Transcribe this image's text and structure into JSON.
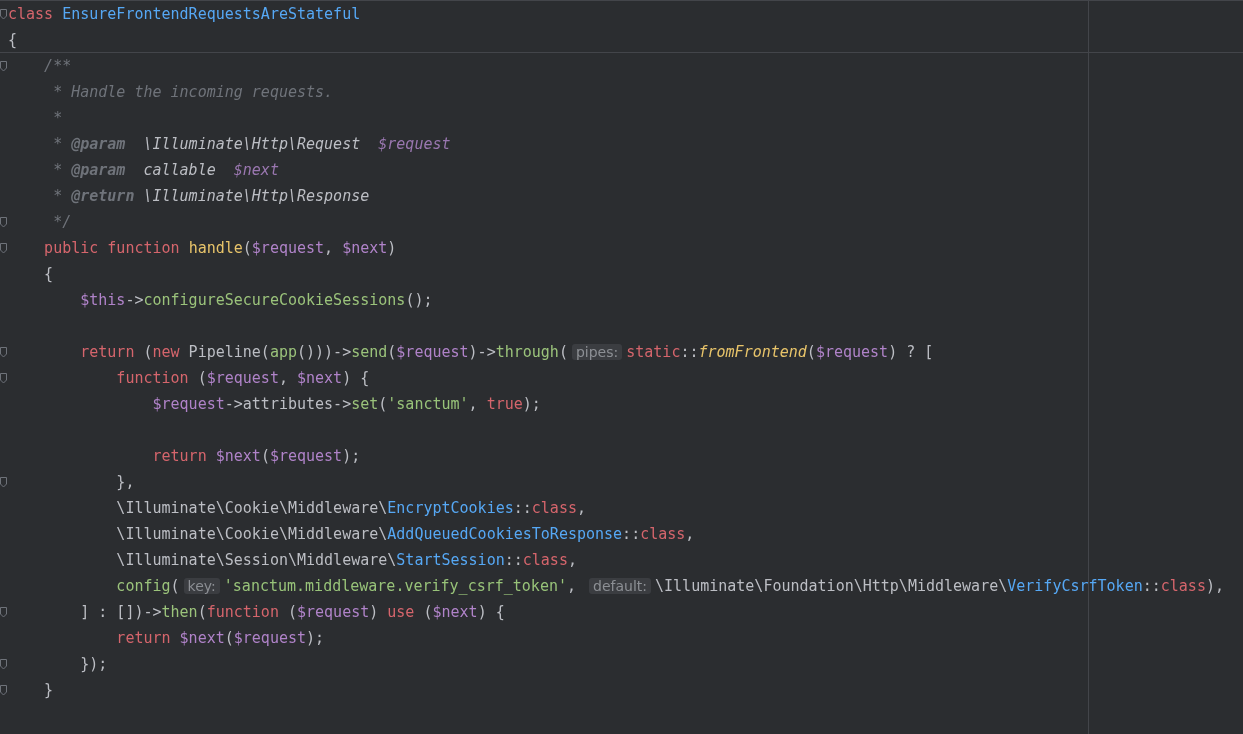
{
  "editor": {
    "lines": [
      {
        "fold": true,
        "tokens": [
          {
            "kind": "keyword",
            "text": "class "
          },
          {
            "kind": "class",
            "text": "EnsureFrontendRequestsAreStateful"
          }
        ]
      },
      {
        "fold": false,
        "tokens": [
          {
            "kind": "plain",
            "text": "{"
          }
        ]
      },
      {
        "fold": true,
        "tokens": [
          {
            "kind": "comment",
            "text": "    /**"
          }
        ]
      },
      {
        "fold": false,
        "tokens": [
          {
            "kind": "comment",
            "text": "     * Handle the incoming requests."
          }
        ]
      },
      {
        "fold": false,
        "tokens": [
          {
            "kind": "comment",
            "text": "     *"
          }
        ]
      },
      {
        "fold": false,
        "tokens": [
          {
            "kind": "comment",
            "text": "     * "
          },
          {
            "kind": "doctag",
            "text": "@param"
          },
          {
            "kind": "doctype",
            "text": "  \\Illuminate\\Http\\Request  "
          },
          {
            "kind": "docvar",
            "text": "$request"
          }
        ]
      },
      {
        "fold": false,
        "tokens": [
          {
            "kind": "comment",
            "text": "     * "
          },
          {
            "kind": "doctag",
            "text": "@param"
          },
          {
            "kind": "doctype",
            "text": "  callable  "
          },
          {
            "kind": "docvar",
            "text": "$next"
          }
        ]
      },
      {
        "fold": false,
        "tokens": [
          {
            "kind": "comment",
            "text": "     * "
          },
          {
            "kind": "doctag",
            "text": "@return"
          },
          {
            "kind": "doctype",
            "text": " \\Illuminate\\Http\\Response"
          }
        ]
      },
      {
        "fold": true,
        "tokens": [
          {
            "kind": "comment",
            "text": "     */"
          }
        ]
      },
      {
        "fold": true,
        "tokens": [
          {
            "kind": "keyword",
            "text": "    public function "
          },
          {
            "kind": "method",
            "text": "handle"
          },
          {
            "kind": "plain",
            "text": "("
          },
          {
            "kind": "variable",
            "text": "$request"
          },
          {
            "kind": "plain",
            "text": ", "
          },
          {
            "kind": "variable",
            "text": "$next"
          },
          {
            "kind": "plain",
            "text": ")"
          }
        ]
      },
      {
        "fold": false,
        "tokens": [
          {
            "kind": "plain",
            "text": "    {"
          }
        ]
      },
      {
        "fold": false,
        "tokens": [
          {
            "kind": "variable",
            "text": "        $this"
          },
          {
            "kind": "plain",
            "text": "->"
          },
          {
            "kind": "call",
            "text": "configureSecureCookieSessions"
          },
          {
            "kind": "plain",
            "text": "();"
          }
        ]
      },
      {
        "fold": false
      },
      {
        "fold": true,
        "tokens": [
          {
            "kind": "keyword",
            "text": "        return"
          },
          {
            "kind": "plain",
            "text": " ("
          },
          {
            "kind": "keyword",
            "text": "new"
          },
          {
            "kind": "plain",
            "text": " Pipeline("
          },
          {
            "kind": "call",
            "text": "app"
          },
          {
            "kind": "plain",
            "text": "()))->"
          },
          {
            "kind": "call",
            "text": "send"
          },
          {
            "kind": "plain",
            "text": "("
          },
          {
            "kind": "variable",
            "text": "$request"
          },
          {
            "kind": "plain",
            "text": ")->"
          },
          {
            "kind": "call",
            "text": "through"
          },
          {
            "kind": "plain",
            "text": "("
          },
          {
            "kind": "hint",
            "text": "pipes:"
          },
          {
            "kind": "keyword",
            "text": "static"
          },
          {
            "kind": "plain",
            "text": "::"
          },
          {
            "kind": "static",
            "text": "fromFrontend"
          },
          {
            "kind": "plain",
            "text": "("
          },
          {
            "kind": "variable",
            "text": "$request"
          },
          {
            "kind": "plain",
            "text": ") ? ["
          }
        ]
      },
      {
        "fold": true,
        "tokens": [
          {
            "kind": "keyword",
            "text": "            function"
          },
          {
            "kind": "plain",
            "text": " ("
          },
          {
            "kind": "variable",
            "text": "$request"
          },
          {
            "kind": "plain",
            "text": ", "
          },
          {
            "kind": "variable",
            "text": "$next"
          },
          {
            "kind": "plain",
            "text": ") {"
          }
        ]
      },
      {
        "fold": false,
        "tokens": [
          {
            "kind": "variable",
            "text": "                $request"
          },
          {
            "kind": "plain",
            "text": "->attributes->"
          },
          {
            "kind": "call",
            "text": "set"
          },
          {
            "kind": "plain",
            "text": "("
          },
          {
            "kind": "string",
            "text": "'sanctum'"
          },
          {
            "kind": "plain",
            "text": ", "
          },
          {
            "kind": "keyword",
            "text": "true"
          },
          {
            "kind": "plain",
            "text": ");"
          }
        ]
      },
      {
        "fold": false
      },
      {
        "fold": false,
        "tokens": [
          {
            "kind": "keyword",
            "text": "                return "
          },
          {
            "kind": "variable",
            "text": "$next"
          },
          {
            "kind": "plain",
            "text": "("
          },
          {
            "kind": "variable",
            "text": "$request"
          },
          {
            "kind": "plain",
            "text": ");"
          }
        ]
      },
      {
        "fold": true,
        "tokens": [
          {
            "kind": "plain",
            "text": "            },"
          }
        ]
      },
      {
        "fold": false,
        "tokens": [
          {
            "kind": "plain",
            "text": "            \\Illuminate\\Cookie\\Middleware\\"
          },
          {
            "kind": "class",
            "text": "EncryptCookies"
          },
          {
            "kind": "plain",
            "text": "::"
          },
          {
            "kind": "keyword",
            "text": "class"
          },
          {
            "kind": "plain",
            "text": ","
          }
        ]
      },
      {
        "fold": false,
        "tokens": [
          {
            "kind": "plain",
            "text": "            \\Illuminate\\Cookie\\Middleware\\"
          },
          {
            "kind": "class",
            "text": "AddQueuedCookiesToResponse"
          },
          {
            "kind": "plain",
            "text": "::"
          },
          {
            "kind": "keyword",
            "text": "class"
          },
          {
            "kind": "plain",
            "text": ","
          }
        ]
      },
      {
        "fold": false,
        "tokens": [
          {
            "kind": "plain",
            "text": "            \\Illuminate\\Session\\Middleware\\"
          },
          {
            "kind": "class",
            "text": "StartSession"
          },
          {
            "kind": "plain",
            "text": "::"
          },
          {
            "kind": "keyword",
            "text": "class"
          },
          {
            "kind": "plain",
            "text": ","
          }
        ]
      },
      {
        "fold": false,
        "tokens": [
          {
            "kind": "call",
            "text": "            config"
          },
          {
            "kind": "plain",
            "text": "("
          },
          {
            "kind": "hint",
            "text": "key:"
          },
          {
            "kind": "string",
            "text": "'sanctum.middleware.verify_csrf_token'"
          },
          {
            "kind": "plain",
            "text": ", "
          },
          {
            "kind": "hint",
            "text": "default:"
          },
          {
            "kind": "plain",
            "text": "\\Illuminate\\Foundation\\Http\\Middleware\\"
          },
          {
            "kind": "class",
            "text": "VerifyCsrfToken"
          },
          {
            "kind": "plain",
            "text": "::"
          },
          {
            "kind": "keyword",
            "text": "class"
          },
          {
            "kind": "plain",
            "text": "),"
          }
        ]
      },
      {
        "fold": true,
        "tokens": [
          {
            "kind": "plain",
            "text": "        ] : [])->"
          },
          {
            "kind": "call",
            "text": "then"
          },
          {
            "kind": "plain",
            "text": "("
          },
          {
            "kind": "keyword",
            "text": "function"
          },
          {
            "kind": "plain",
            "text": " ("
          },
          {
            "kind": "variable",
            "text": "$request"
          },
          {
            "kind": "plain",
            "text": ") "
          },
          {
            "kind": "keyword",
            "text": "use"
          },
          {
            "kind": "plain",
            "text": " ("
          },
          {
            "kind": "variable",
            "text": "$next"
          },
          {
            "kind": "plain",
            "text": ") {"
          }
        ]
      },
      {
        "fold": false,
        "tokens": [
          {
            "kind": "keyword",
            "text": "            return "
          },
          {
            "kind": "variable",
            "text": "$next"
          },
          {
            "kind": "plain",
            "text": "("
          },
          {
            "kind": "variable",
            "text": "$request"
          },
          {
            "kind": "plain",
            "text": ");"
          }
        ]
      },
      {
        "fold": true,
        "tokens": [
          {
            "kind": "plain",
            "text": "        });"
          }
        ]
      },
      {
        "fold": true,
        "tokens": [
          {
            "kind": "plain",
            "text": "    }"
          }
        ]
      }
    ]
  }
}
